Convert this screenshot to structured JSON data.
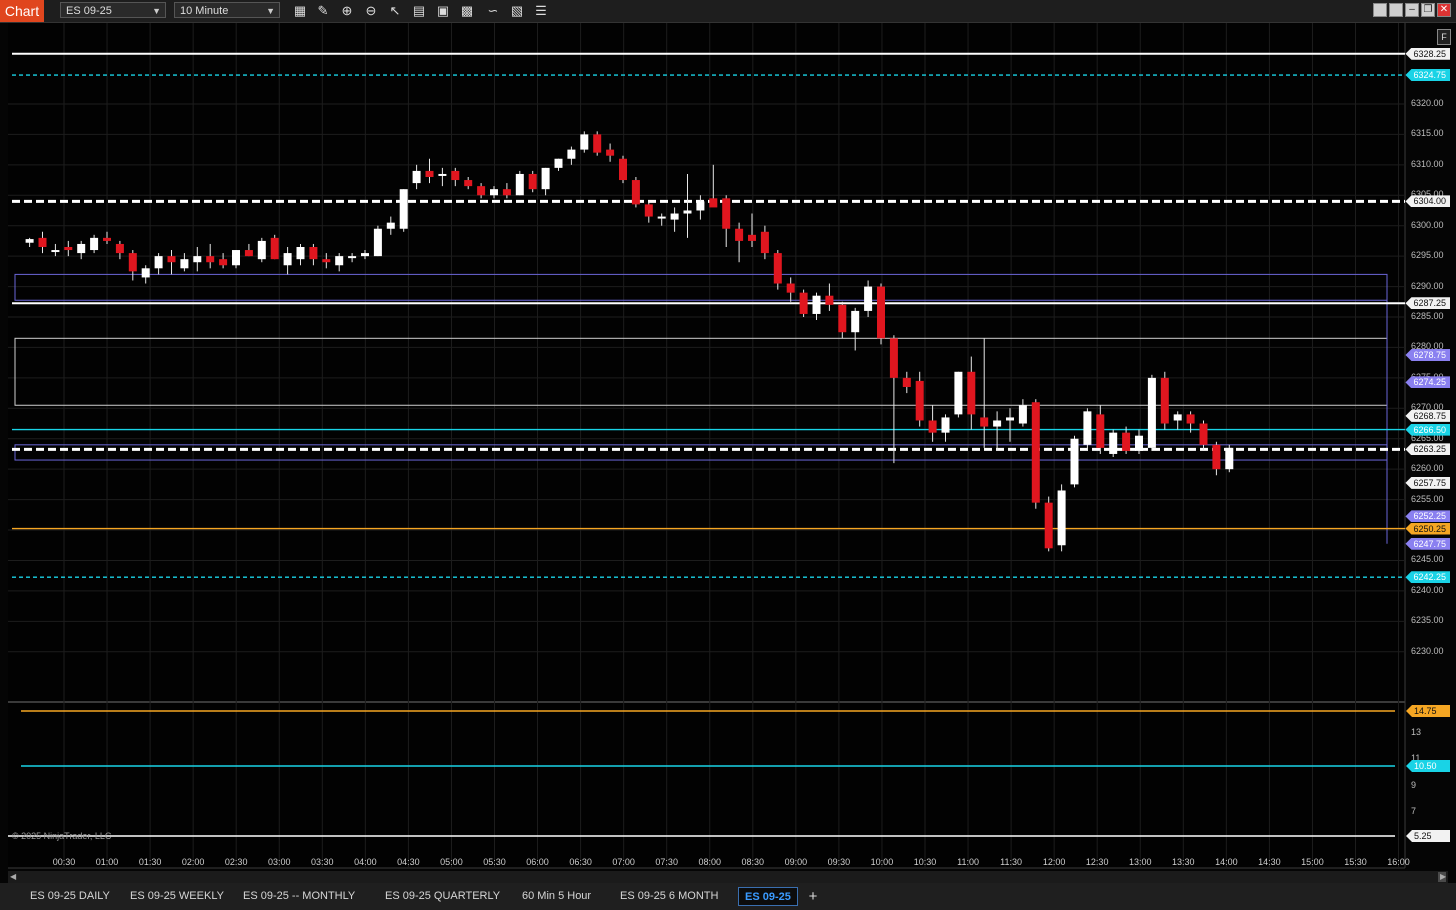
{
  "app": {
    "title": "Chart"
  },
  "toolbar": {
    "instrument": "ES 09-25",
    "interval": "10 Minute",
    "icons": [
      "bars-type-icon",
      "drawing-pencil-icon",
      "zoom-in-icon",
      "zoom-out-icon",
      "pointer-icon",
      "data-box-icon",
      "properties-icon",
      "strategies-icon",
      "indicators-icon",
      "templates-icon",
      "list-icon"
    ]
  },
  "window": {
    "icons": [
      "tile-icon",
      "tile-icon-2",
      "minimize-icon",
      "restore-icon",
      "close-icon"
    ]
  },
  "colors": {
    "up": "#ffffff",
    "down": "#e0161f",
    "cyan": "#19d3e6",
    "orange": "#f5a623",
    "purple": "#8a80f0",
    "zone": "#6b66d8"
  },
  "price_axis": {
    "ticks": [
      "6320.00",
      "6315.00",
      "6310.00",
      "6305.00",
      "6300.00",
      "6295.00",
      "6290.00",
      "6285.00",
      "6280.00",
      "6275.00",
      "6270.00",
      "6265.00",
      "6260.00",
      "6255.00",
      "6250.00",
      "6245.00",
      "6240.00",
      "6235.00",
      "6230.00"
    ],
    "labels": [
      {
        "text": "6328.25",
        "kind": "white"
      },
      {
        "text": "6324.75",
        "kind": "cyan"
      },
      {
        "text": "6304.00",
        "kind": "white"
      },
      {
        "text": "6287.25",
        "kind": "white"
      },
      {
        "text": "6278.75",
        "kind": "purple"
      },
      {
        "text": "6274.25",
        "kind": "purple"
      },
      {
        "text": "6268.75",
        "kind": "white"
      },
      {
        "text": "6266.50",
        "kind": "cyan"
      },
      {
        "text": "6263.25",
        "kind": "white"
      },
      {
        "text": "6257.75",
        "kind": "white"
      },
      {
        "text": "6252.25",
        "kind": "purple"
      },
      {
        "text": "6250.25",
        "kind": "orange"
      },
      {
        "text": "6247.75",
        "kind": "purple"
      },
      {
        "text": "6242.25",
        "kind": "cyan"
      }
    ]
  },
  "lower_panel": {
    "ticks": [
      "13",
      "11",
      "9",
      "7"
    ],
    "labels": [
      {
        "text": "14.75",
        "kind": "orange"
      },
      {
        "text": "10.50",
        "kind": "cyan"
      },
      {
        "text": "5.25",
        "kind": "white"
      }
    ]
  },
  "time_axis": [
    "00:30",
    "01:00",
    "01:30",
    "02:00",
    "02:30",
    "03:00",
    "03:30",
    "04:00",
    "04:30",
    "05:00",
    "05:30",
    "06:00",
    "06:30",
    "07:00",
    "07:30",
    "08:00",
    "08:30",
    "09:00",
    "09:30",
    "10:00",
    "10:30",
    "11:00",
    "11:30",
    "12:00",
    "12:30",
    "13:00",
    "13:30",
    "14:00",
    "14:30",
    "15:00",
    "15:30",
    "16:00"
  ],
  "copyright": "© 2025 NinjaTrader, LLC",
  "f_button": "F",
  "tabs": [
    {
      "label": "ES 09-25 DAILY",
      "active": false
    },
    {
      "label": "ES 09-25 WEEKLY",
      "active": false
    },
    {
      "label": "ES 09-25 -- MONTHLY",
      "active": false
    },
    {
      "label": "ES 09-25 QUARTERLY",
      "active": false
    },
    {
      "label": "60 Min 5 Hour",
      "active": false
    },
    {
      "label": "ES 09-25 6 MONTH",
      "active": false
    },
    {
      "label": "ES 09-25",
      "active": true
    }
  ],
  "tab_add": "+",
  "chart_data": {
    "type": "candlestick",
    "instrument": "ES 09-25",
    "interval": "10 Minute",
    "y_range": [
      6227.5,
      6331
    ],
    "levels": [
      {
        "price": 6328.25,
        "style": "solid",
        "color": "white"
      },
      {
        "price": 6324.75,
        "style": "dashed",
        "color": "cyan"
      },
      {
        "price": 6304.0,
        "style": "dashed",
        "color": "white"
      },
      {
        "price": 6287.25,
        "style": "solid",
        "color": "white"
      },
      {
        "price": 6266.5,
        "style": "solid",
        "color": "cyan"
      },
      {
        "price": 6263.25,
        "style": "dashed",
        "color": "white"
      },
      {
        "price": 6250.25,
        "style": "solid",
        "color": "orange"
      },
      {
        "price": 6242.25,
        "style": "dashed",
        "color": "cyan"
      }
    ],
    "zones": [
      {
        "top": 6292.0,
        "bottom": 6287.75
      },
      {
        "top": 6281.5,
        "bottom": 6270.5
      },
      {
        "top": 6264.0,
        "bottom": 6261.5
      }
    ],
    "candles": [
      {
        "t": 0.2,
        "o": 6297.2,
        "h": 6298.0,
        "l": 6296.5,
        "c": 6297.8
      },
      {
        "t": 0.5,
        "o": 6298.0,
        "h": 6299.0,
        "l": 6295.5,
        "c": 6296.5
      },
      {
        "t": 0.8,
        "o": 6296.0,
        "h": 6297.0,
        "l": 6295.0,
        "c": 6296.0
      },
      {
        "t": 1.1,
        "o": 6296.5,
        "h": 6297.5,
        "l": 6295.0,
        "c": 6296.0
      },
      {
        "t": 1.4,
        "o": 6295.5,
        "h": 6297.5,
        "l": 6294.5,
        "c": 6297.0
      },
      {
        "t": 1.7,
        "o": 6296.0,
        "h": 6298.5,
        "l": 6295.5,
        "c": 6298.0
      },
      {
        "t": 2.0,
        "o": 6298.0,
        "h": 6299.0,
        "l": 6297.0,
        "c": 6297.5
      },
      {
        "t": 2.3,
        "o": 6297.0,
        "h": 6297.5,
        "l": 6294.5,
        "c": 6295.5
      },
      {
        "t": 2.6,
        "o": 6295.5,
        "h": 6296.0,
        "l": 6291.0,
        "c": 6292.5
      },
      {
        "t": 2.9,
        "o": 6291.5,
        "h": 6293.5,
        "l": 6290.5,
        "c": 6293.0
      },
      {
        "t": 3.2,
        "o": 6293.0,
        "h": 6295.5,
        "l": 6292.0,
        "c": 6295.0
      },
      {
        "t": 3.5,
        "o": 6295.0,
        "h": 6296.0,
        "l": 6292.0,
        "c": 6294.0
      },
      {
        "t": 3.8,
        "o": 6293.0,
        "h": 6295.5,
        "l": 6292.5,
        "c": 6294.5
      },
      {
        "t": 4.1,
        "o": 6294.0,
        "h": 6296.5,
        "l": 6292.5,
        "c": 6295.0
      },
      {
        "t": 4.4,
        "o": 6295.0,
        "h": 6297.0,
        "l": 6293.0,
        "c": 6294.0
      },
      {
        "t": 4.7,
        "o": 6294.5,
        "h": 6295.5,
        "l": 6293.0,
        "c": 6293.5
      },
      {
        "t": 5.0,
        "o": 6293.5,
        "h": 6296.0,
        "l": 6293.0,
        "c": 6296.0
      },
      {
        "t": 5.3,
        "o": 6296.0,
        "h": 6297.0,
        "l": 6295.0,
        "c": 6295.0
      },
      {
        "t": 5.6,
        "o": 6294.5,
        "h": 6298.0,
        "l": 6294.0,
        "c": 6297.5
      },
      {
        "t": 5.9,
        "o": 6298.0,
        "h": 6298.5,
        "l": 6294.5,
        "c": 6294.5
      },
      {
        "t": 6.2,
        "o": 6293.5,
        "h": 6296.5,
        "l": 6292.0,
        "c": 6295.5
      },
      {
        "t": 6.5,
        "o": 6294.5,
        "h": 6297.0,
        "l": 6293.5,
        "c": 6296.5
      },
      {
        "t": 6.8,
        "o": 6296.5,
        "h": 6297.0,
        "l": 6293.5,
        "c": 6294.5
      },
      {
        "t": 7.1,
        "o": 6294.5,
        "h": 6295.5,
        "l": 6293.0,
        "c": 6294.0
      },
      {
        "t": 7.4,
        "o": 6293.5,
        "h": 6295.5,
        "l": 6292.5,
        "c": 6295.0
      },
      {
        "t": 7.7,
        "o": 6295.0,
        "h": 6295.5,
        "l": 6294.0,
        "c": 6295.0
      },
      {
        "t": 8.0,
        "o": 6295.0,
        "h": 6296.0,
        "l": 6294.5,
        "c": 6295.5
      },
      {
        "t": 8.3,
        "o": 6295.0,
        "h": 6300.0,
        "l": 6295.0,
        "c": 6299.5
      },
      {
        "t": 8.6,
        "o": 6299.5,
        "h": 6301.5,
        "l": 6298.5,
        "c": 6300.5
      },
      {
        "t": 8.9,
        "o": 6299.5,
        "h": 6306.0,
        "l": 6299.0,
        "c": 6306.0
      },
      {
        "t": 9.2,
        "o": 6307.0,
        "h": 6310.0,
        "l": 6306.0,
        "c": 6309.0
      },
      {
        "t": 9.5,
        "o": 6309.0,
        "h": 6311.0,
        "l": 6307.0,
        "c": 6308.0
      },
      {
        "t": 9.8,
        "o": 6308.5,
        "h": 6309.5,
        "l": 6306.5,
        "c": 6308.5
      },
      {
        "t": 10.1,
        "o": 6309.0,
        "h": 6309.5,
        "l": 6306.5,
        "c": 6307.5
      },
      {
        "t": 10.4,
        "o": 6307.5,
        "h": 6308.0,
        "l": 6306.0,
        "c": 6306.5
      },
      {
        "t": 10.7,
        "o": 6306.5,
        "h": 6307.0,
        "l": 6304.5,
        "c": 6305.0
      },
      {
        "t": 11.0,
        "o": 6305.0,
        "h": 6306.5,
        "l": 6304.5,
        "c": 6306.0
      },
      {
        "t": 11.3,
        "o": 6306.0,
        "h": 6307.0,
        "l": 6304.5,
        "c": 6305.0
      },
      {
        "t": 11.6,
        "o": 6305.0,
        "h": 6309.0,
        "l": 6305.0,
        "c": 6308.5
      },
      {
        "t": 11.9,
        "o": 6308.5,
        "h": 6309.0,
        "l": 6305.5,
        "c": 6306.0
      },
      {
        "t": 12.2,
        "o": 6306.0,
        "h": 6309.5,
        "l": 6305.0,
        "c": 6309.5
      },
      {
        "t": 12.5,
        "o": 6309.5,
        "h": 6311.0,
        "l": 6309.0,
        "c": 6311.0
      },
      {
        "t": 12.8,
        "o": 6311.0,
        "h": 6313.0,
        "l": 6310.0,
        "c": 6312.5
      },
      {
        "t": 13.1,
        "o": 6312.5,
        "h": 6315.5,
        "l": 6312.0,
        "c": 6315.0
      },
      {
        "t": 13.4,
        "o": 6315.0,
        "h": 6315.5,
        "l": 6311.5,
        "c": 6312.0
      },
      {
        "t": 13.7,
        "o": 6312.5,
        "h": 6313.5,
        "l": 6310.5,
        "c": 6311.5
      },
      {
        "t": 14.0,
        "o": 6311.0,
        "h": 6311.5,
        "l": 6307.0,
        "c": 6307.5
      },
      {
        "t": 14.3,
        "o": 6307.5,
        "h": 6308.0,
        "l": 6303.0,
        "c": 6303.5
      },
      {
        "t": 14.6,
        "o": 6303.5,
        "h": 6304.0,
        "l": 6300.5,
        "c": 6301.5
      },
      {
        "t": 14.9,
        "o": 6301.5,
        "h": 6302.0,
        "l": 6300.0,
        "c": 6301.5
      },
      {
        "t": 15.2,
        "o": 6301.0,
        "h": 6303.0,
        "l": 6299.0,
        "c": 6302.0
      },
      {
        "t": 15.5,
        "o": 6302.0,
        "h": 6308.5,
        "l": 6298.0,
        "c": 6302.5
      },
      {
        "t": 15.8,
        "o": 6302.5,
        "h": 6305.0,
        "l": 6301.0,
        "c": 6304.0
      },
      {
        "t": 16.1,
        "o": 6304.5,
        "h": 6310.0,
        "l": 6303.5,
        "c": 6303.0
      },
      {
        "t": 16.4,
        "o": 6304.5,
        "h": 6305.0,
        "l": 6296.5,
        "c": 6299.5
      },
      {
        "t": 16.7,
        "o": 6299.5,
        "h": 6300.5,
        "l": 6294.0,
        "c": 6297.5
      },
      {
        "t": 17.0,
        "o": 6298.5,
        "h": 6302.0,
        "l": 6296.5,
        "c": 6297.5
      },
      {
        "t": 17.3,
        "o": 6299.0,
        "h": 6300.0,
        "l": 6294.5,
        "c": 6295.5
      },
      {
        "t": 17.6,
        "o": 6295.5,
        "h": 6296.0,
        "l": 6289.5,
        "c": 6290.5
      },
      {
        "t": 17.9,
        "o": 6290.5,
        "h": 6291.5,
        "l": 6287.5,
        "c": 6289.0
      },
      {
        "t": 18.2,
        "o": 6289.0,
        "h": 6289.5,
        "l": 6285.0,
        "c": 6285.5
      },
      {
        "t": 18.5,
        "o": 6285.5,
        "h": 6289.0,
        "l": 6284.5,
        "c": 6288.5
      },
      {
        "t": 18.8,
        "o": 6288.5,
        "h": 6290.5,
        "l": 6286.0,
        "c": 6287.0
      },
      {
        "t": 19.1,
        "o": 6287.0,
        "h": 6287.5,
        "l": 6281.5,
        "c": 6282.5
      },
      {
        "t": 19.4,
        "o": 6282.5,
        "h": 6286.5,
        "l": 6279.5,
        "c": 6286.0
      },
      {
        "t": 19.7,
        "o": 6286.0,
        "h": 6291.0,
        "l": 6285.0,
        "c": 6290.0
      },
      {
        "t": 20.0,
        "o": 6290.0,
        "h": 6290.5,
        "l": 6280.5,
        "c": 6281.5
      },
      {
        "t": 20.3,
        "o": 6281.5,
        "h": 6282.0,
        "l": 6261.0,
        "c": 6275.0
      },
      {
        "t": 20.6,
        "o": 6275.0,
        "h": 6276.0,
        "l": 6272.5,
        "c": 6273.5
      },
      {
        "t": 20.9,
        "o": 6274.5,
        "h": 6276.0,
        "l": 6267.0,
        "c": 6268.0
      },
      {
        "t": 21.2,
        "o": 6268.0,
        "h": 6270.5,
        "l": 6264.5,
        "c": 6266.0
      },
      {
        "t": 21.5,
        "o": 6266.0,
        "h": 6269.0,
        "l": 6264.5,
        "c": 6268.5
      },
      {
        "t": 21.8,
        "o": 6269.0,
        "h": 6276.0,
        "l": 6268.5,
        "c": 6276.0
      },
      {
        "t": 22.1,
        "o": 6276.0,
        "h": 6278.5,
        "l": 6266.5,
        "c": 6269.0
      },
      {
        "t": 22.4,
        "o": 6268.5,
        "h": 6281.5,
        "l": 6263.5,
        "c": 6267.0
      },
      {
        "t": 22.7,
        "o": 6267.0,
        "h": 6269.5,
        "l": 6263.0,
        "c": 6268.0
      },
      {
        "t": 23.0,
        "o": 6268.0,
        "h": 6270.0,
        "l": 6264.5,
        "c": 6268.5
      },
      {
        "t": 23.3,
        "o": 6267.5,
        "h": 6271.5,
        "l": 6267.0,
        "c": 6270.5
      },
      {
        "t": 23.6,
        "o": 6271.0,
        "h": 6271.5,
        "l": 6253.5,
        "c": 6254.5
      },
      {
        "t": 23.9,
        "o": 6254.5,
        "h": 6255.5,
        "l": 6246.5,
        "c": 6247.0
      },
      {
        "t": 24.2,
        "o": 6247.5,
        "h": 6257.5,
        "l": 6246.5,
        "c": 6256.5
      },
      {
        "t": 24.5,
        "o": 6257.5,
        "h": 6265.5,
        "l": 6257.0,
        "c": 6265.0
      },
      {
        "t": 24.8,
        "o": 6264.0,
        "h": 6270.0,
        "l": 6263.0,
        "c": 6269.5
      },
      {
        "t": 25.1,
        "o": 6269.0,
        "h": 6270.5,
        "l": 6262.5,
        "c": 6263.5
      },
      {
        "t": 25.4,
        "o": 6262.5,
        "h": 6266.5,
        "l": 6262.0,
        "c": 6266.0
      },
      {
        "t": 25.7,
        "o": 6266.0,
        "h": 6267.0,
        "l": 6262.5,
        "c": 6263.0
      },
      {
        "t": 26.0,
        "o": 6263.0,
        "h": 6266.5,
        "l": 6262.5,
        "c": 6265.5
      },
      {
        "t": 26.3,
        "o": 6263.5,
        "h": 6275.5,
        "l": 6263.0,
        "c": 6275.0
      },
      {
        "t": 26.6,
        "o": 6275.0,
        "h": 6276.0,
        "l": 6266.5,
        "c": 6267.5
      },
      {
        "t": 26.9,
        "o": 6268.0,
        "h": 6269.5,
        "l": 6266.5,
        "c": 6269.0
      },
      {
        "t": 27.2,
        "o": 6269.0,
        "h": 6269.5,
        "l": 6266.0,
        "c": 6267.5
      },
      {
        "t": 27.5,
        "o": 6267.5,
        "h": 6268.0,
        "l": 6263.0,
        "c": 6264.0
      },
      {
        "t": 27.8,
        "o": 6264.0,
        "h": 6264.5,
        "l": 6259.0,
        "c": 6260.0
      },
      {
        "t": 28.1,
        "o": 6260.0,
        "h": 6264.0,
        "l": 6259.5,
        "c": 6263.5
      }
    ]
  }
}
